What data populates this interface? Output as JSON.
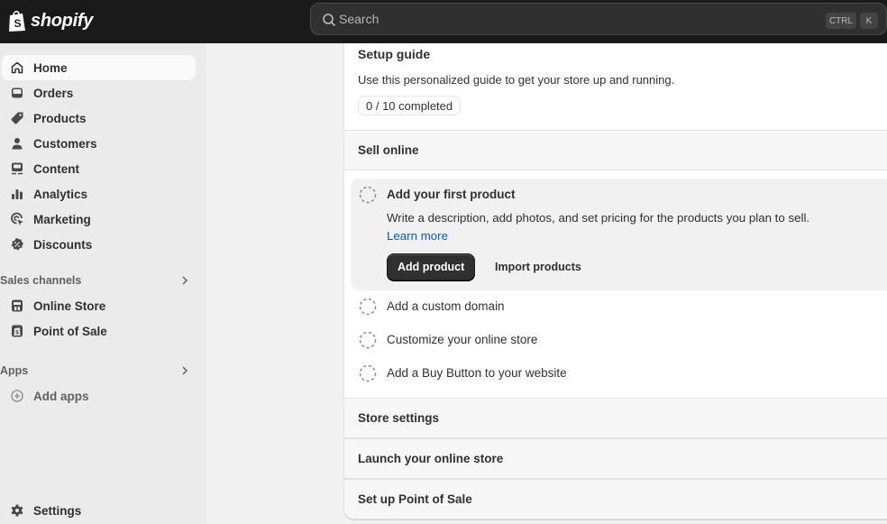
{
  "topbar": {
    "brand": "shopify",
    "search": {
      "placeholder": "Search",
      "shortcut_keys": [
        "CTRL",
        "K"
      ]
    }
  },
  "sidebar": {
    "items": [
      {
        "label": "Home",
        "icon": "home-icon",
        "active": true
      },
      {
        "label": "Orders",
        "icon": "inbox-icon"
      },
      {
        "label": "Products",
        "icon": "tag-icon"
      },
      {
        "label": "Customers",
        "icon": "person-icon"
      },
      {
        "label": "Content",
        "icon": "image-monitor-icon"
      },
      {
        "label": "Analytics",
        "icon": "bar-chart-icon"
      },
      {
        "label": "Marketing",
        "icon": "target-cursor-icon"
      },
      {
        "label": "Discounts",
        "icon": "discount-badge-icon"
      }
    ],
    "sales_channels": {
      "label": "Sales channels",
      "items": [
        {
          "label": "Online Store",
          "icon": "store-icon"
        },
        {
          "label": "Point of Sale",
          "icon": "pos-bag-icon"
        }
      ]
    },
    "apps": {
      "label": "Apps",
      "items": [
        {
          "label": "Add apps",
          "icon": "plus-circle-icon"
        }
      ]
    },
    "settings": {
      "label": "Settings",
      "icon": "gear-icon"
    }
  },
  "setup_guide": {
    "title": "Setup guide",
    "description": "Use this personalized guide to get your store up and running.",
    "progress": {
      "completed": 0,
      "total": 10,
      "label": "0 / 10 completed"
    },
    "groups": [
      {
        "title": "Sell online",
        "tasks": [
          {
            "title": "Add your first product",
            "expanded": true,
            "body": "Write a description, add photos, and set pricing for the products you plan to sell.",
            "link": "Learn more",
            "primary_action": "Add product",
            "secondary_action": "Import products"
          },
          {
            "title": "Add a custom domain"
          },
          {
            "title": "Customize your online store"
          },
          {
            "title": "Add a Buy Button to your website"
          }
        ]
      },
      {
        "title": "Store settings"
      },
      {
        "title": "Launch your online store"
      },
      {
        "title": "Set up Point of Sale"
      }
    ]
  },
  "colors": {
    "topbar_bg": "#1a1a1a",
    "sidebar_bg": "#ebebeb",
    "link": "#005bd3",
    "primary_button": "#303030"
  }
}
